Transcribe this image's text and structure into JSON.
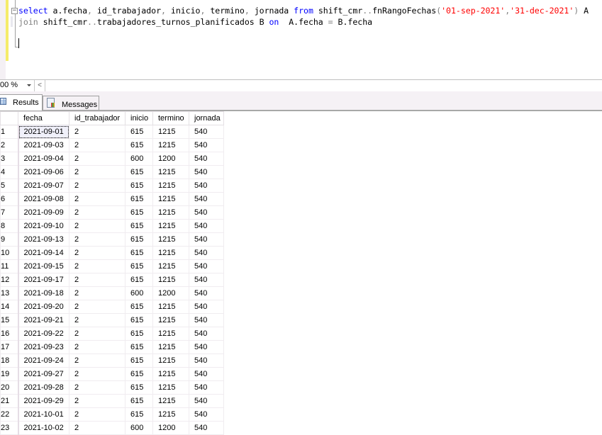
{
  "editor": {
    "collapse_glyph": "−",
    "line1": {
      "kw_select": "select",
      "text1": " a.fecha",
      "comma1": ",",
      "text2": " id_trabajador",
      "comma2": ",",
      "text3": " inicio",
      "comma3": ",",
      "text4": " termino",
      "comma4": ",",
      "text5": " jornada ",
      "kw_from": "from",
      "text6": " shift_cmr",
      "dots": "..",
      "text7": "fnRangoFechas",
      "paren_open": "(",
      "str1": "'01-sep-2021'",
      "comma5": ",",
      "str2": "'31-dec-2021'",
      "paren_close": ")",
      "text8": " A"
    },
    "line2": {
      "kw_join": "join",
      "text1": " shift_cmr",
      "dots": "..",
      "text2": "trabajadores_turnos_planificados B ",
      "kw_on": "on",
      "text3": "  A.fecha ",
      "eq": "=",
      "text4": " B.fecha"
    }
  },
  "zoombar": {
    "zoom_value": "00 %",
    "scroll_left_glyph": "<"
  },
  "tabs": [
    {
      "label": "Results",
      "icon": "grid-icon",
      "active": true
    },
    {
      "label": "Messages",
      "icon": "messages-icon",
      "active": false
    }
  ],
  "grid": {
    "columns": [
      "",
      "fecha",
      "id_trabajador",
      "inicio",
      "termino",
      "jornada"
    ],
    "rows": [
      [
        "1",
        "2021-09-01",
        "2",
        "615",
        "1215",
        "540"
      ],
      [
        "2",
        "2021-09-03",
        "2",
        "615",
        "1215",
        "540"
      ],
      [
        "3",
        "2021-09-04",
        "2",
        "600",
        "1200",
        "540"
      ],
      [
        "4",
        "2021-09-06",
        "2",
        "615",
        "1215",
        "540"
      ],
      [
        "5",
        "2021-09-07",
        "2",
        "615",
        "1215",
        "540"
      ],
      [
        "6",
        "2021-09-08",
        "2",
        "615",
        "1215",
        "540"
      ],
      [
        "7",
        "2021-09-09",
        "2",
        "615",
        "1215",
        "540"
      ],
      [
        "8",
        "2021-09-10",
        "2",
        "615",
        "1215",
        "540"
      ],
      [
        "9",
        "2021-09-13",
        "2",
        "615",
        "1215",
        "540"
      ],
      [
        "10",
        "2021-09-14",
        "2",
        "615",
        "1215",
        "540"
      ],
      [
        "11",
        "2021-09-15",
        "2",
        "615",
        "1215",
        "540"
      ],
      [
        "12",
        "2021-09-17",
        "2",
        "615",
        "1215",
        "540"
      ],
      [
        "13",
        "2021-09-18",
        "2",
        "600",
        "1200",
        "540"
      ],
      [
        "14",
        "2021-09-20",
        "2",
        "615",
        "1215",
        "540"
      ],
      [
        "15",
        "2021-09-21",
        "2",
        "615",
        "1215",
        "540"
      ],
      [
        "16",
        "2021-09-22",
        "2",
        "615",
        "1215",
        "540"
      ],
      [
        "17",
        "2021-09-23",
        "2",
        "615",
        "1215",
        "540"
      ],
      [
        "18",
        "2021-09-24",
        "2",
        "615",
        "1215",
        "540"
      ],
      [
        "19",
        "2021-09-27",
        "2",
        "615",
        "1215",
        "540"
      ],
      [
        "20",
        "2021-09-28",
        "2",
        "615",
        "1215",
        "540"
      ],
      [
        "21",
        "2021-09-29",
        "2",
        "615",
        "1215",
        "540"
      ],
      [
        "22",
        "2021-10-01",
        "2",
        "615",
        "1215",
        "540"
      ],
      [
        "23",
        "2021-10-02",
        "2",
        "600",
        "1200",
        "540"
      ]
    ],
    "selected_cell": {
      "row": 0,
      "col": 1
    }
  }
}
